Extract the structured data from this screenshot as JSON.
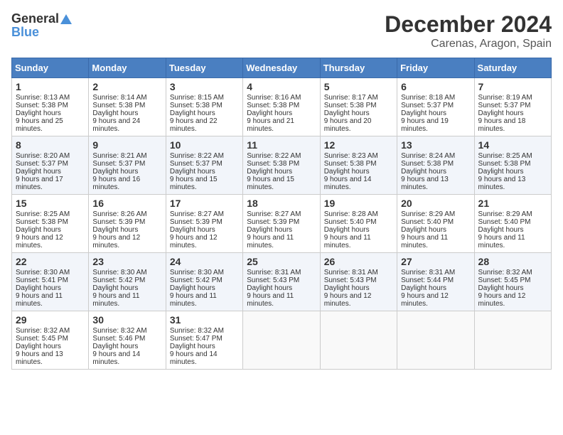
{
  "header": {
    "logo_general": "General",
    "logo_blue": "Blue",
    "title": "December 2024",
    "subtitle": "Carenas, Aragon, Spain"
  },
  "days_of_week": [
    "Sunday",
    "Monday",
    "Tuesday",
    "Wednesday",
    "Thursday",
    "Friday",
    "Saturday"
  ],
  "weeks": [
    [
      {
        "day": "1",
        "sunrise": "8:13 AM",
        "sunset": "5:38 PM",
        "daylight": "9 hours and 25 minutes."
      },
      {
        "day": "2",
        "sunrise": "8:14 AM",
        "sunset": "5:38 PM",
        "daylight": "9 hours and 24 minutes."
      },
      {
        "day": "3",
        "sunrise": "8:15 AM",
        "sunset": "5:38 PM",
        "daylight": "9 hours and 22 minutes."
      },
      {
        "day": "4",
        "sunrise": "8:16 AM",
        "sunset": "5:38 PM",
        "daylight": "9 hours and 21 minutes."
      },
      {
        "day": "5",
        "sunrise": "8:17 AM",
        "sunset": "5:38 PM",
        "daylight": "9 hours and 20 minutes."
      },
      {
        "day": "6",
        "sunrise": "8:18 AM",
        "sunset": "5:37 PM",
        "daylight": "9 hours and 19 minutes."
      },
      {
        "day": "7",
        "sunrise": "8:19 AM",
        "sunset": "5:37 PM",
        "daylight": "9 hours and 18 minutes."
      }
    ],
    [
      {
        "day": "8",
        "sunrise": "8:20 AM",
        "sunset": "5:37 PM",
        "daylight": "9 hours and 17 minutes."
      },
      {
        "day": "9",
        "sunrise": "8:21 AM",
        "sunset": "5:37 PM",
        "daylight": "9 hours and 16 minutes."
      },
      {
        "day": "10",
        "sunrise": "8:22 AM",
        "sunset": "5:37 PM",
        "daylight": "9 hours and 15 minutes."
      },
      {
        "day": "11",
        "sunrise": "8:22 AM",
        "sunset": "5:38 PM",
        "daylight": "9 hours and 15 minutes."
      },
      {
        "day": "12",
        "sunrise": "8:23 AM",
        "sunset": "5:38 PM",
        "daylight": "9 hours and 14 minutes."
      },
      {
        "day": "13",
        "sunrise": "8:24 AM",
        "sunset": "5:38 PM",
        "daylight": "9 hours and 13 minutes."
      },
      {
        "day": "14",
        "sunrise": "8:25 AM",
        "sunset": "5:38 PM",
        "daylight": "9 hours and 13 minutes."
      }
    ],
    [
      {
        "day": "15",
        "sunrise": "8:25 AM",
        "sunset": "5:38 PM",
        "daylight": "9 hours and 12 minutes."
      },
      {
        "day": "16",
        "sunrise": "8:26 AM",
        "sunset": "5:39 PM",
        "daylight": "9 hours and 12 minutes."
      },
      {
        "day": "17",
        "sunrise": "8:27 AM",
        "sunset": "5:39 PM",
        "daylight": "9 hours and 12 minutes."
      },
      {
        "day": "18",
        "sunrise": "8:27 AM",
        "sunset": "5:39 PM",
        "daylight": "9 hours and 11 minutes."
      },
      {
        "day": "19",
        "sunrise": "8:28 AM",
        "sunset": "5:40 PM",
        "daylight": "9 hours and 11 minutes."
      },
      {
        "day": "20",
        "sunrise": "8:29 AM",
        "sunset": "5:40 PM",
        "daylight": "9 hours and 11 minutes."
      },
      {
        "day": "21",
        "sunrise": "8:29 AM",
        "sunset": "5:40 PM",
        "daylight": "9 hours and 11 minutes."
      }
    ],
    [
      {
        "day": "22",
        "sunrise": "8:30 AM",
        "sunset": "5:41 PM",
        "daylight": "9 hours and 11 minutes."
      },
      {
        "day": "23",
        "sunrise": "8:30 AM",
        "sunset": "5:42 PM",
        "daylight": "9 hours and 11 minutes."
      },
      {
        "day": "24",
        "sunrise": "8:30 AM",
        "sunset": "5:42 PM",
        "daylight": "9 hours and 11 minutes."
      },
      {
        "day": "25",
        "sunrise": "8:31 AM",
        "sunset": "5:43 PM",
        "daylight": "9 hours and 11 minutes."
      },
      {
        "day": "26",
        "sunrise": "8:31 AM",
        "sunset": "5:43 PM",
        "daylight": "9 hours and 12 minutes."
      },
      {
        "day": "27",
        "sunrise": "8:31 AM",
        "sunset": "5:44 PM",
        "daylight": "9 hours and 12 minutes."
      },
      {
        "day": "28",
        "sunrise": "8:32 AM",
        "sunset": "5:45 PM",
        "daylight": "9 hours and 12 minutes."
      }
    ],
    [
      {
        "day": "29",
        "sunrise": "8:32 AM",
        "sunset": "5:45 PM",
        "daylight": "9 hours and 13 minutes."
      },
      {
        "day": "30",
        "sunrise": "8:32 AM",
        "sunset": "5:46 PM",
        "daylight": "9 hours and 14 minutes."
      },
      {
        "day": "31",
        "sunrise": "8:32 AM",
        "sunset": "5:47 PM",
        "daylight": "9 hours and 14 minutes."
      },
      null,
      null,
      null,
      null
    ]
  ]
}
